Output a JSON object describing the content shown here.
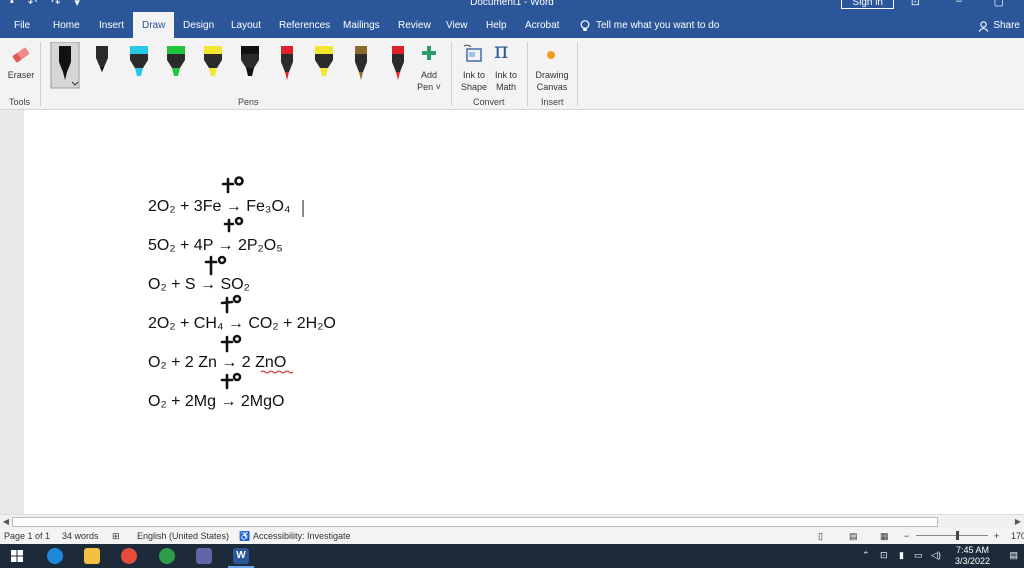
{
  "window": {
    "title": "Document1 - Word",
    "sign_in": "Sign in"
  },
  "tabs": [
    "File",
    "Home",
    "Insert",
    "Draw",
    "Design",
    "Layout",
    "References",
    "Mailings",
    "Review",
    "View",
    "Help",
    "Acrobat"
  ],
  "active_tab": "Draw",
  "tell_me": "Tell me what you want to do",
  "share": "Share",
  "ribbon": {
    "tools": {
      "eraser": "Eraser",
      "group": "Tools"
    },
    "pens_group": "Pens",
    "pens": [
      {
        "color": "#111111",
        "type": "pen"
      },
      {
        "color": "#111111",
        "type": "pencil"
      },
      {
        "color": "#28c7e6",
        "type": "highlighter"
      },
      {
        "color": "#21c43a",
        "type": "highlighter"
      },
      {
        "color": "#f3e62c",
        "type": "highlighter"
      },
      {
        "color": "#111111",
        "type": "highlighter"
      },
      {
        "color": "#e0212a",
        "type": "pen"
      },
      {
        "color": "#f3e62c",
        "type": "highlighter"
      },
      {
        "color": "#8a6a2a",
        "type": "galaxy"
      },
      {
        "color": "#e0212a",
        "type": "sparkle"
      }
    ],
    "add_pen": [
      "Add",
      "Pen ˅"
    ],
    "convert": {
      "ink_to_shape": [
        "Ink to",
        "Shape"
      ],
      "ink_to_math": [
        "Ink to",
        "Math"
      ],
      "group": "Convert"
    },
    "insert": {
      "drawing_canvas": [
        "Drawing",
        "Canvas"
      ],
      "group": "Insert"
    }
  },
  "document": {
    "equations": [
      "2O₂ + 3Fe → Fe₃O₄",
      "5O₂ + 4P → 2P₂O₅",
      "O₂ + S → SO₂",
      "2O₂ + CH₄ → CO₂ + 2H₂O",
      "O₂ + 2 Zn → 2 ZnO",
      "O₂ + 2Mg → 2MgO"
    ],
    "ink_annotation": "+t°"
  },
  "status": {
    "page": "Page 1 of 1",
    "words": "34 words",
    "language": "English (United States)",
    "accessibility": "Accessibility: Investigate",
    "zoom": "170"
  },
  "taskbar": {
    "time": "7:45 AM",
    "date": "3/3/2022"
  },
  "colors": {
    "word_blue": "#2b579a",
    "ribbon_bg": "#f3f3f3",
    "taskbar_bg": "#1c2a3a"
  }
}
